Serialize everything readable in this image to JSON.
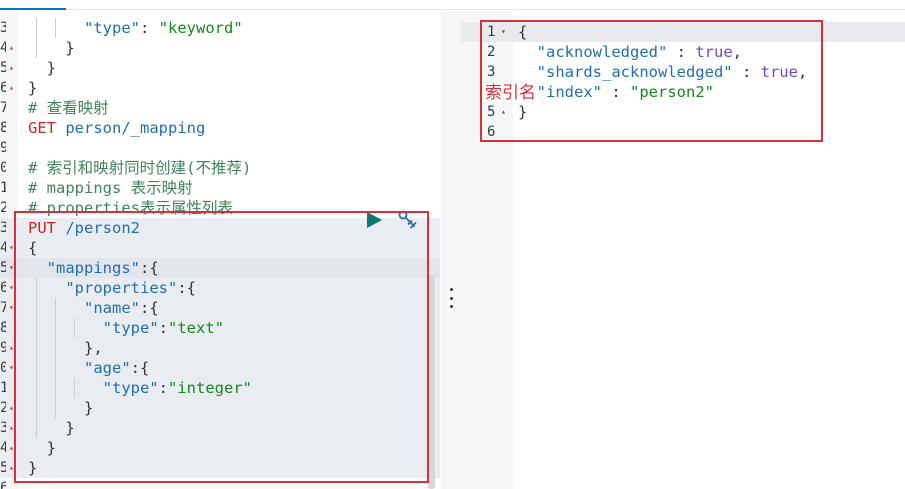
{
  "left_editor": {
    "lines": [
      {
        "num": "3",
        "fold": "",
        "indent_guides": 2,
        "tokens": [
          {
            "t": "      "
          },
          {
            "t": "\"type\"",
            "c": "key"
          },
          {
            "t": ": ",
            "c": "punc"
          },
          {
            "t": "\"keyword\"",
            "c": "str"
          }
        ]
      },
      {
        "num": "4",
        "fold": "▴",
        "indent_guides": 1,
        "tokens": [
          {
            "t": "    }",
            "c": "punc"
          }
        ]
      },
      {
        "num": "5",
        "fold": "▴",
        "indent_guides": 0,
        "tokens": [
          {
            "t": "  }",
            "c": "punc"
          }
        ]
      },
      {
        "num": "6",
        "fold": "▴",
        "indent_guides": 0,
        "tokens": [
          {
            "t": "}",
            "c": "punc"
          }
        ]
      },
      {
        "num": "7",
        "fold": "",
        "indent_guides": 0,
        "tokens": [
          {
            "t": "# 查看映射",
            "c": "comment"
          }
        ]
      },
      {
        "num": "8",
        "fold": "",
        "indent_guides": 0,
        "tokens": [
          {
            "t": "GET",
            "c": "method"
          },
          {
            "t": " person/_mapping",
            "c": "path"
          }
        ]
      },
      {
        "num": "9",
        "fold": "",
        "indent_guides": 0,
        "tokens": [
          {
            "t": ""
          }
        ]
      },
      {
        "num": "0",
        "fold": "",
        "indent_guides": 0,
        "tokens": [
          {
            "t": "# 索引和映射同时创建(不推荐)",
            "c": "comment"
          }
        ]
      },
      {
        "num": "1",
        "fold": "",
        "indent_guides": 0,
        "tokens": [
          {
            "t": "# mappings 表示映射",
            "c": "comment"
          }
        ]
      },
      {
        "num": "2",
        "fold": "",
        "indent_guides": 0,
        "tokens": [
          {
            "t": "# properties表示属性列表",
            "c": "comment"
          }
        ]
      },
      {
        "num": "3",
        "fold": "",
        "indent_guides": 0,
        "tokens": [
          {
            "t": "PUT",
            "c": "method"
          },
          {
            "t": " /person2",
            "c": "path"
          }
        ]
      },
      {
        "num": "4",
        "fold": "▾",
        "indent_guides": 0,
        "tokens": [
          {
            "t": "{",
            "c": "punc"
          }
        ]
      },
      {
        "num": "5",
        "fold": "▾",
        "indent_guides": 0,
        "highlight": true,
        "tokens": [
          {
            "t": "  "
          },
          {
            "t": "\"mappings\"",
            "c": "key"
          },
          {
            "t": ":{",
            "c": "punc"
          }
        ]
      },
      {
        "num": "6",
        "fold": "▾",
        "indent_guides": 1,
        "tokens": [
          {
            "t": "    "
          },
          {
            "t": "\"properties\"",
            "c": "key"
          },
          {
            "t": ":{",
            "c": "punc"
          }
        ]
      },
      {
        "num": "7",
        "fold": "▾",
        "indent_guides": 2,
        "tokens": [
          {
            "t": "      "
          },
          {
            "t": "\"name\"",
            "c": "key"
          },
          {
            "t": ":{",
            "c": "punc"
          }
        ]
      },
      {
        "num": "8",
        "fold": "",
        "indent_guides": 3,
        "tokens": [
          {
            "t": "        "
          },
          {
            "t": "\"type\"",
            "c": "key"
          },
          {
            "t": ":",
            "c": "punc"
          },
          {
            "t": "\"text\"",
            "c": "str"
          }
        ]
      },
      {
        "num": "9",
        "fold": "▴",
        "indent_guides": 2,
        "tokens": [
          {
            "t": "      },",
            "c": "punc"
          }
        ]
      },
      {
        "num": "0",
        "fold": "▾",
        "indent_guides": 2,
        "tokens": [
          {
            "t": "      "
          },
          {
            "t": "\"age\"",
            "c": "key"
          },
          {
            "t": ":{",
            "c": "punc"
          }
        ]
      },
      {
        "num": "1",
        "fold": "",
        "indent_guides": 3,
        "tokens": [
          {
            "t": "        "
          },
          {
            "t": "\"type\"",
            "c": "key"
          },
          {
            "t": ":",
            "c": "punc"
          },
          {
            "t": "\"integer\"",
            "c": "str"
          }
        ]
      },
      {
        "num": "2",
        "fold": "▴",
        "indent_guides": 2,
        "tokens": [
          {
            "t": "      }",
            "c": "punc"
          }
        ]
      },
      {
        "num": "3",
        "fold": "▴",
        "indent_guides": 1,
        "tokens": [
          {
            "t": "    }",
            "c": "punc"
          }
        ]
      },
      {
        "num": "4",
        "fold": "▴",
        "indent_guides": 0,
        "tokens": [
          {
            "t": "  }",
            "c": "punc"
          }
        ]
      },
      {
        "num": "5",
        "fold": "▴",
        "indent_guides": 0,
        "tokens": [
          {
            "t": "}",
            "c": "punc"
          }
        ]
      },
      {
        "num": "6",
        "fold": "",
        "indent_guides": 0,
        "tokens": [
          {
            "t": ""
          }
        ]
      }
    ]
  },
  "right_response": {
    "lines": [
      {
        "num": "1",
        "fold": "▾",
        "active": true,
        "tokens": [
          {
            "t": "{",
            "c": "punc"
          }
        ]
      },
      {
        "num": "2",
        "fold": "",
        "tokens": [
          {
            "t": "  "
          },
          {
            "t": "\"acknowledged\"",
            "c": "key"
          },
          {
            "t": " : ",
            "c": "punc"
          },
          {
            "t": "true",
            "c": "bool"
          },
          {
            "t": ",",
            "c": "punc"
          }
        ]
      },
      {
        "num": "3",
        "fold": "",
        "tokens": [
          {
            "t": "  "
          },
          {
            "t": "\"shards_acknowledged\"",
            "c": "key"
          },
          {
            "t": " : ",
            "c": "punc"
          },
          {
            "t": "true",
            "c": "bool"
          },
          {
            "t": ",",
            "c": "punc"
          }
        ]
      },
      {
        "num": "4",
        "fold": "",
        "tokens": [
          {
            "t": "  "
          },
          {
            "t": "\"index\"",
            "c": "key"
          },
          {
            "t": " : ",
            "c": "punc"
          },
          {
            "t": "\"person2\"",
            "c": "str"
          }
        ]
      },
      {
        "num": "5",
        "fold": "▴",
        "tokens": [
          {
            "t": "}",
            "c": "punc"
          }
        ]
      },
      {
        "num": "6",
        "fold": "",
        "tokens": [
          {
            "t": ""
          }
        ]
      }
    ]
  },
  "annotation": {
    "label": "索引名",
    "color": "#d6303a"
  },
  "icons": {
    "run": "play-icon",
    "settings": "wrench-icon"
  },
  "colors": {
    "key": "#1f6fb2",
    "string": "#17881b",
    "method": "#c62828",
    "comment": "#41845e",
    "run_button": "#0a7a6e",
    "tab_active": "#0077cc"
  }
}
